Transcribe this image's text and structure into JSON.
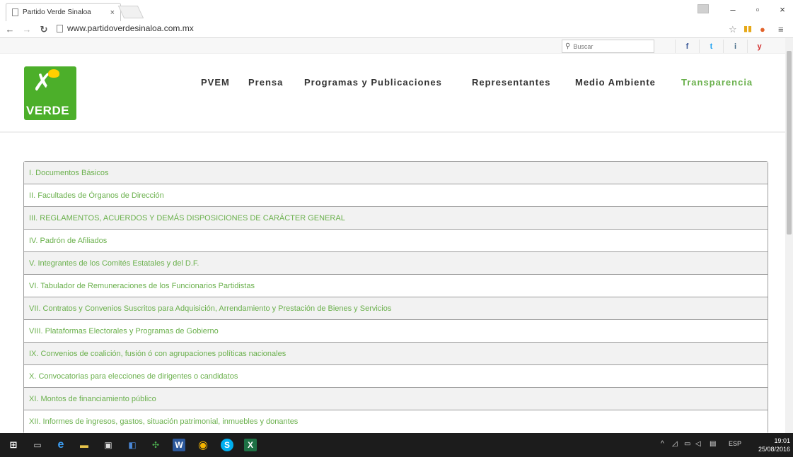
{
  "browser": {
    "tab_title": "Partido Verde Sinaloa",
    "tab_close": "×",
    "url": "www.partidoverdesinaloa.com.mx",
    "minimize": "–",
    "restore": "▫",
    "close": "×"
  },
  "header": {
    "search_placeholder": "Buscar",
    "logo_text": "VERDE",
    "social": [
      "f",
      "t",
      "i",
      "y"
    ],
    "menu": [
      "PVEM",
      "Prensa",
      "Programas y Publicaciones",
      "Representantes",
      "Medio Ambiente",
      "Transparencia"
    ]
  },
  "items": [
    "I. Documentos Básicos",
    "II. Facultades de Órganos de Dirección",
    "III. REGLAMENTOS, ACUERDOS Y DEMÁS DISPOSICIONES DE CARÁCTER GENERAL",
    "IV. Padrón de Afiliados",
    "V. Integrantes de los Comités Estatales y del D.F.",
    "VI. Tabulador de Remuneraciones de los Funcionarios Partidistas",
    "VII. Contratos y Convenios Suscritos para Adquisición, Arrendamiento y Prestación de Bienes y Servicios",
    "VIII. Plataformas Electorales y Programas de Gobierno",
    "IX. Convenios de coalición, fusión ó con agrupaciones políticas nacionales",
    "X. Convocatorias para elecciones de dirigentes o candidatos",
    "XI. Montos de financiamiento público",
    "XII. Informes de ingresos, gastos, situación patrimonial, inmuebles y donantes"
  ],
  "taskbar": {
    "lang": "ESP",
    "time": "19:01",
    "date": "25/08/2016"
  },
  "colors": {
    "accent_green": "#6ab04c",
    "logo_green": "#4caf2a"
  }
}
